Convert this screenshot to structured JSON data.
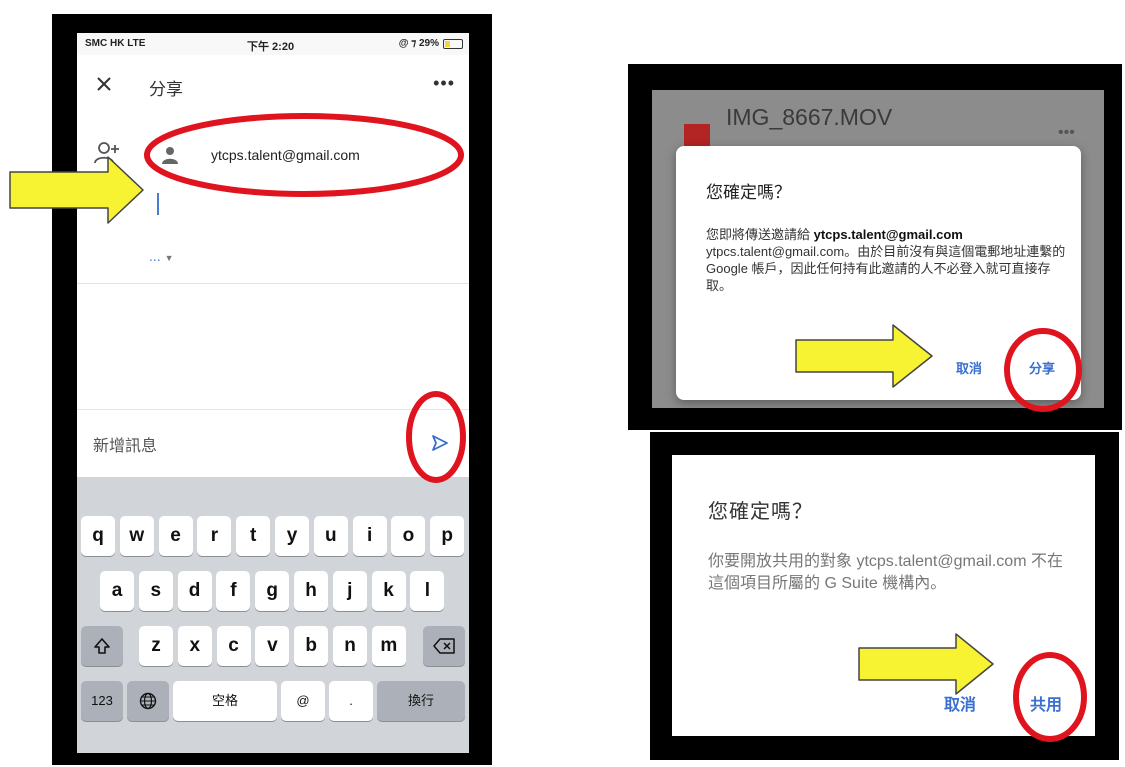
{
  "colors": {
    "accent": "#3a6fd0",
    "annotation_circle": "#e0141e",
    "annotation_arrow": "#f7f232",
    "file_icon": "#b32424"
  },
  "status_bar": {
    "carrier": "SMC HK  LTE",
    "time": "下午 2:20",
    "battery": "@ ⁊ 29%",
    "battery_level": 0.29
  },
  "share_screen": {
    "close_icon": "close-icon",
    "title": "分享",
    "more": "•••",
    "recipient_email": "ytcps.talent@gmail.com",
    "role_dropdown": "...",
    "message_placeholder": "新增訊息",
    "send_icon": "send-icon"
  },
  "keyboard": {
    "row1": [
      "q",
      "w",
      "e",
      "r",
      "t",
      "y",
      "u",
      "i",
      "o",
      "p"
    ],
    "row2": [
      "a",
      "s",
      "d",
      "f",
      "g",
      "h",
      "j",
      "k",
      "l"
    ],
    "row3": [
      "z",
      "x",
      "c",
      "v",
      "b",
      "n",
      "m"
    ],
    "numbers_key": "123",
    "space_key": "空格",
    "at_key": "@",
    "dot_key": ".",
    "return_key": "換行"
  },
  "dialog1": {
    "file_name": "IMG_8667.MOV",
    "file_more": "•••",
    "title": "您確定嗎？",
    "body_prefix": "您即將傳送邀請給 ",
    "body_email_bold": "ytcps.talent@gmail.com",
    "body_rest": "ytpcs.talent@gmail.com。由於目前沒有與這個電郵地址連繫的 Google 帳戶，因此任何持有此邀請的人不必登入就可直接存取。",
    "cancel": "取消",
    "confirm": "分享"
  },
  "dialog2": {
    "title": "您確定嗎？",
    "body": "你要開放共用的對象 ytcps.talent@gmail.com 不在這個項目所屬的 G Suite 機構內。",
    "cancel": "取消",
    "confirm": "共用"
  }
}
